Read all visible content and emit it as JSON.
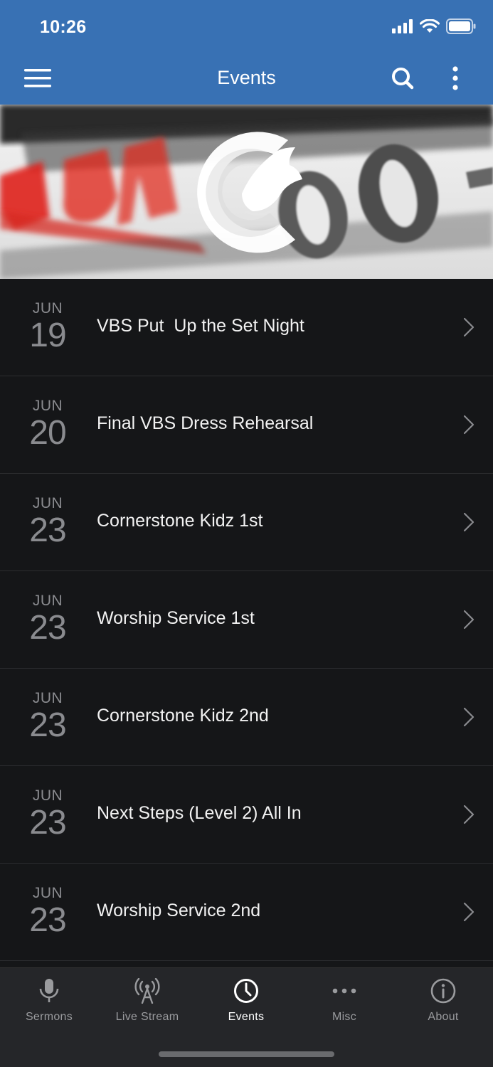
{
  "status_bar": {
    "time": "10:26"
  },
  "header": {
    "title": "Events"
  },
  "events": [
    {
      "month": "JUN",
      "day": "19",
      "title": "VBS Put  Up the Set Night"
    },
    {
      "month": "JUN",
      "day": "20",
      "title": "Final VBS Dress Rehearsal"
    },
    {
      "month": "JUN",
      "day": "23",
      "title": "Cornerstone Kidz 1st"
    },
    {
      "month": "JUN",
      "day": "23",
      "title": "Worship Service 1st"
    },
    {
      "month": "JUN",
      "day": "23",
      "title": "Cornerstone Kidz 2nd"
    },
    {
      "month": "JUN",
      "day": "23",
      "title": "Next Steps (Level 2) All In"
    },
    {
      "month": "JUN",
      "day": "23",
      "title": "Worship Service 2nd"
    }
  ],
  "tabs": [
    {
      "label": "Sermons",
      "icon": "microphone-icon"
    },
    {
      "label": "Live Stream",
      "icon": "broadcast-icon"
    },
    {
      "label": "Events",
      "icon": "clock-icon",
      "active": true
    },
    {
      "label": "Misc",
      "icon": "more-dots-icon"
    },
    {
      "label": "About",
      "icon": "info-icon"
    }
  ],
  "colors": {
    "header": "#3871b4",
    "background": "#151618",
    "tabbar": "#252629"
  }
}
